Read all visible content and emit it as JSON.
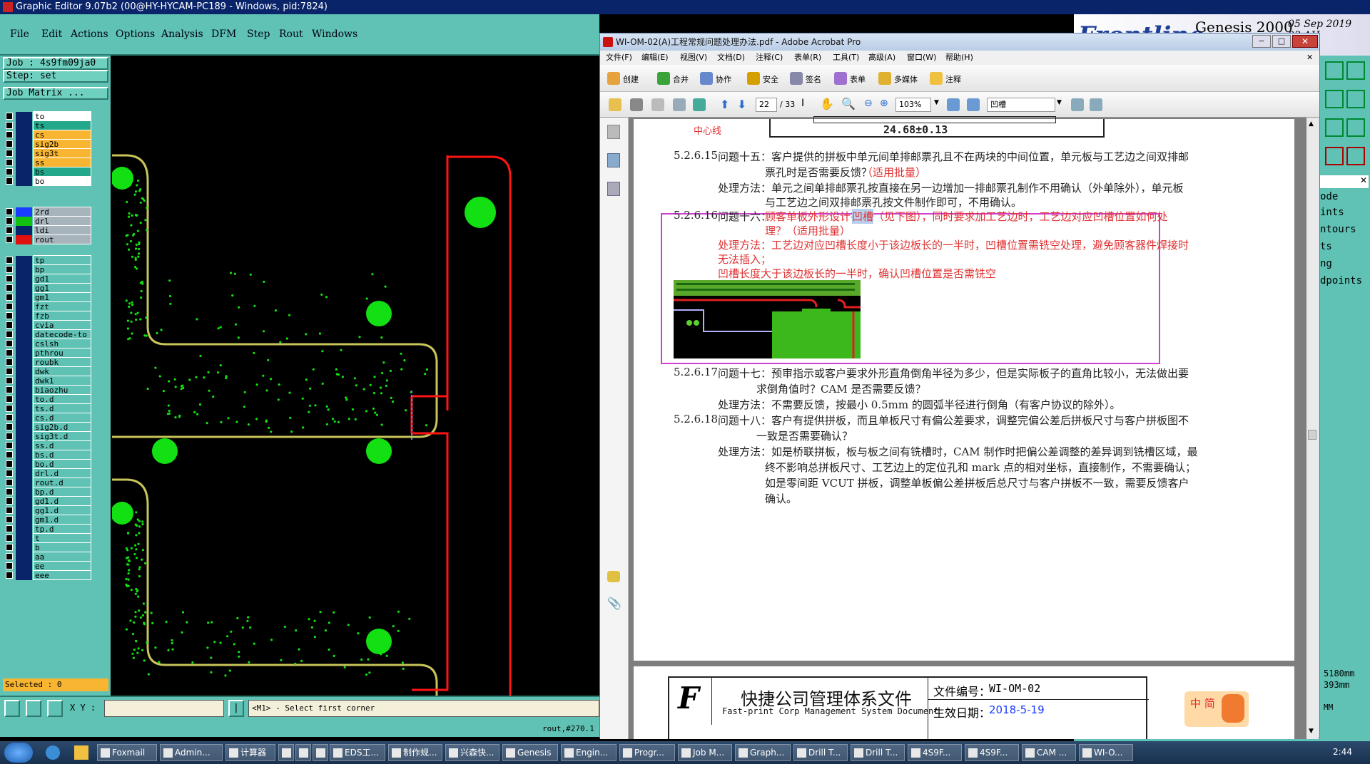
{
  "ge": {
    "title": "Graphic Editor 9.07b2 (00@HY-HYCAM-PC189 - Windows, pid:7824)",
    "menu": [
      "File",
      "Edit",
      "Actions",
      "Options",
      "Analysis",
      "DFM",
      "Step",
      "Rout",
      "Windows"
    ],
    "job": "Job : 4s9fm09ja0",
    "step": "Step: set",
    "job_matrix": "Job Matrix ...",
    "layers_top": [
      {
        "name": "to",
        "color": "#ffffff"
      },
      {
        "name": "ts",
        "color": "#24a88c"
      },
      {
        "name": "cs",
        "color": "#f7b531"
      },
      {
        "name": "sig2b",
        "color": "#f7b531"
      },
      {
        "name": "sig3t",
        "color": "#f7b531"
      },
      {
        "name": "ss",
        "color": "#f7b531"
      },
      {
        "name": "bs",
        "color": "#24a88c"
      },
      {
        "name": "bo",
        "color": "#ffffff"
      }
    ],
    "layers_drill": [
      {
        "name": "2rd",
        "swatch": "#1a3cff",
        "color": "#a8b4bc"
      },
      {
        "name": "drl",
        "swatch": "#12c012",
        "color": "#a8b4bc"
      },
      {
        "name": "ldi",
        "swatch": "#0a246a",
        "color": "#a8b4bc"
      },
      {
        "name": "rout",
        "swatch": "#e01010",
        "color": "#a8b4bc"
      }
    ],
    "layers_misc": [
      "tp",
      "bp",
      "gd1",
      "gg1",
      "gm1",
      "fzt",
      "fzb",
      "cvia",
      "datecode-to",
      "cslsh",
      "pthrou",
      "roubk",
      "dwk",
      "dwk1",
      "biaozhu",
      "to.d",
      "ts.d",
      "cs.d",
      "sig2b.d",
      "sig3t.d",
      "ss.d",
      "bs.d",
      "bo.d",
      "drl.d",
      "rout.d",
      "bp.d",
      "gd1.d",
      "gg1.d",
      "gm1.d",
      "tp.d",
      "t",
      "b",
      "aa",
      "ee",
      "eee"
    ],
    "selected": "Selected : 0",
    "xy_label": "X Y :",
    "prompt": "<M1> - Select first corner",
    "status": "rout,#270.1"
  },
  "genesis": {
    "brand": "Frontline",
    "product": "Genesis 2000",
    "date": "05 Sep 2019",
    "time": "03 AH",
    "side_labels": [
      "ode",
      "ints",
      "ntours",
      "ts",
      "ng",
      "dpoints"
    ],
    "coord1": "5180mm",
    "coord2": "393mm",
    "mm": "MM"
  },
  "acro": {
    "title": "WI-OM-02(A)工程常规问题处理办法.pdf - Adobe Acrobat Pro",
    "menu": [
      "文件(F)",
      "编辑(E)",
      "视图(V)",
      "文档(D)",
      "注释(C)",
      "表单(R)",
      "工具(T)",
      "高级(A)",
      "窗口(W)",
      "帮助(H)"
    ],
    "tb1": [
      "创建",
      "合并",
      "协作",
      "安全",
      "签名",
      "表单",
      "多媒体",
      "注释"
    ],
    "page_current": "22",
    "page_total": "/ 33",
    "zoom": "103%",
    "search": "凹槽",
    "doc": {
      "dimension": "24.68±0.13",
      "red_label": "中心线",
      "q15_num": "5.2.6.15",
      "q15_line1": "问题十五：客户提供的拼板中单元间单排邮票孔且不在两块的中间位置，单元板与工艺边之间双排邮",
      "q15_line2a": "票孔时是否需要反馈？",
      "q15_line2b": "（适用批量）",
      "q15_m1": "处理方法：单元之间单排邮票孔按直接在另一边增加一排邮票孔制作不用确认（外单除外），单元板",
      "q15_m2": "与工艺边之间双排邮票孔按文件制作即可，不用确认。",
      "q16_num": "5.2.6.16",
      "q16_pre": "问题十六：",
      "q16_line1a": "顾客单板外形设计有",
      "q16_hl": "凹槽",
      "q16_line1b": "（见下图），同时要求加工艺边时，工艺边对应凹槽位置如何处",
      "q16_line2": "理？（适用批量）",
      "q16_m1": "处理方法：工艺边对应凹槽长度小于该边板长的一半时，凹槽位置需铣空处理，避免顾客器件焊接时",
      "q16_m2": "无法插入；",
      "q16_m3": "凹槽长度大于该边板长的一半时，确认凹槽位置是否需铣空",
      "q17_num": "5.2.6.17",
      "q17_line1": "问题十七：预审指示或客户要求外形直角倒角半径为多少，但是实际板子的直角比较小，无法做出要",
      "q17_line2": "求倒角值时？CAM 是否需要反馈？",
      "q17_m1": "处理方法：不需要反馈，按最小 0.5mm 的圆弧半径进行倒角（有客户协议的除外）。",
      "q18_num": "5.2.6.18",
      "q18_line1": "问题十八：客户有提供拼板，而且单板尺寸有偏公差要求，调整完偏公差后拼板尺寸与客户拼板图不",
      "q18_line2": "一致是否需要确认？",
      "q18_m1": "处理方法：如是桥联拼板，板与板之间有铣槽时，CAM 制作时把偏公差调整的差异调到铣槽区域，最",
      "q18_m2": "终不影响总拼板尺寸、工艺边上的定位孔和 mark 点的相对坐标，直接制作，不需要确认；",
      "q18_m3": "如是零间距 VCUT 拼板，调整单板偏公差拼板后总尺寸与客户拼板不一致，需要反馈客户",
      "q18_m4": "确认。"
    },
    "footer": {
      "title_cn": "快捷公司管理体系文件",
      "title_en": "Fast-print Corp Management System Document",
      "code_label": "文件编号：",
      "code": "WI-OM-02",
      "date_label": "生效日期：",
      "date": "2018-5-19"
    }
  },
  "ime": "中 简",
  "taskbar": {
    "items": [
      "Foxmail",
      "Admin...",
      "计算器",
      "",
      "",
      "",
      "EDS工...",
      "制作规...",
      "兴森快...",
      "Genesis",
      "Engin...",
      "Progr...",
      "Job M...",
      "Graph...",
      "Drill T...",
      "Drill T...",
      "4S9F...",
      "4S9F...",
      "CAM ...",
      "WI-O..."
    ],
    "clock": "2:44"
  },
  "colors": {
    "teal": "#5fc2b4",
    "pcb_line": "#c8c45a",
    "pad": "#12e012",
    "rout": "#ff1414",
    "highlight": "#d040d0"
  }
}
